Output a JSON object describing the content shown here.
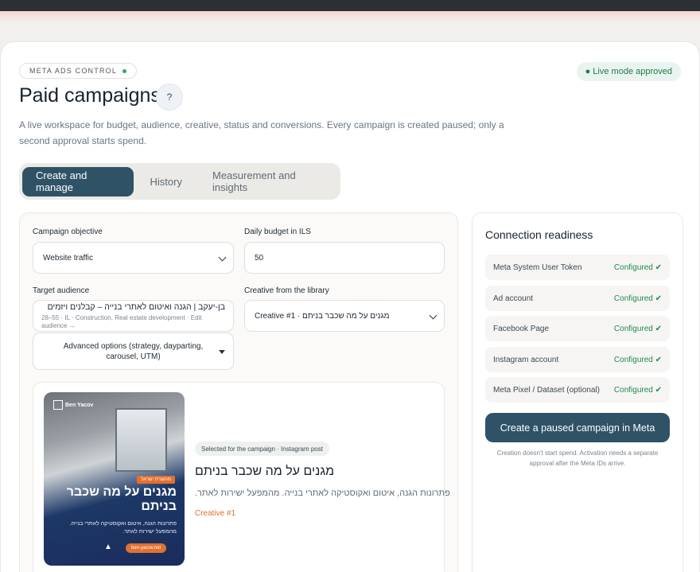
{
  "header": {
    "badge": "META ADS CONTROL",
    "live_status": "● Live mode approved",
    "title": "Paid campaigns",
    "help": "?",
    "subtitle": "A live workspace for budget, audience, creative, status and conversions. Every campaign is created paused; only a second approval starts spend."
  },
  "tabs": [
    {
      "label": "Create and manage",
      "active": true
    },
    {
      "label": "History",
      "active": false
    },
    {
      "label": "Measurement and insights",
      "active": false
    }
  ],
  "form": {
    "objective_label": "Campaign objective",
    "objective_value": "Website traffic",
    "budget_label": "Daily budget in ILS",
    "budget_value": "50",
    "audience_label": "Target audience",
    "audience_name": "בן-יעקב | הגנה ואיטום לאתרי בנייה – קבלנים ויזמים",
    "audience_meta": "28–55 · IL · Construction, Real estate development · Edit audience →",
    "creative_label": "Creative from the library",
    "creative_value": "Creative #1 · מגנים על מה שכבר בניתם",
    "advanced_label": "Advanced options (strategy, dayparting, carousel, UTM)"
  },
  "preview": {
    "poster_brand": "Ben Yacov",
    "poster_tag": "מתוצרת ישראל",
    "poster_headline": "מגנים על מה שכבר בניתם",
    "poster_desc": "פתרונות הגנה, איטום ואקוסטיקה לאתרי בנייה. מהמפעל ישירות לאתר.",
    "poster_url": "ben-yacov.net",
    "selected_badge": "Selected for the campaign · Instagram post",
    "creative_title": "מגנים על מה שכבר בניתם",
    "creative_desc": "פתרונות הגנה, איטום ואקוסטיקה לאתרי בנייה. מהמפעל ישירות לאתר.",
    "creative_number": "Creative #1"
  },
  "readiness": {
    "title": "Connection readiness",
    "items": [
      {
        "label": "Meta System User Token",
        "status": "Configured ✔"
      },
      {
        "label": "Ad account",
        "status": "Configured ✔"
      },
      {
        "label": "Facebook Page",
        "status": "Configured ✔"
      },
      {
        "label": "Instagram account",
        "status": "Configured ✔"
      },
      {
        "label": "Meta Pixel / Dataset (optional)",
        "status": "Configured ✔"
      }
    ],
    "cta": "Create a paused campaign in Meta",
    "note": "Creation doesn't start spend. Activation needs a separate approval after the Meta IDs arrive."
  },
  "colors": {
    "accent": "#2f5266",
    "success": "#1f8a50",
    "brand_orange": "#e2702f"
  }
}
